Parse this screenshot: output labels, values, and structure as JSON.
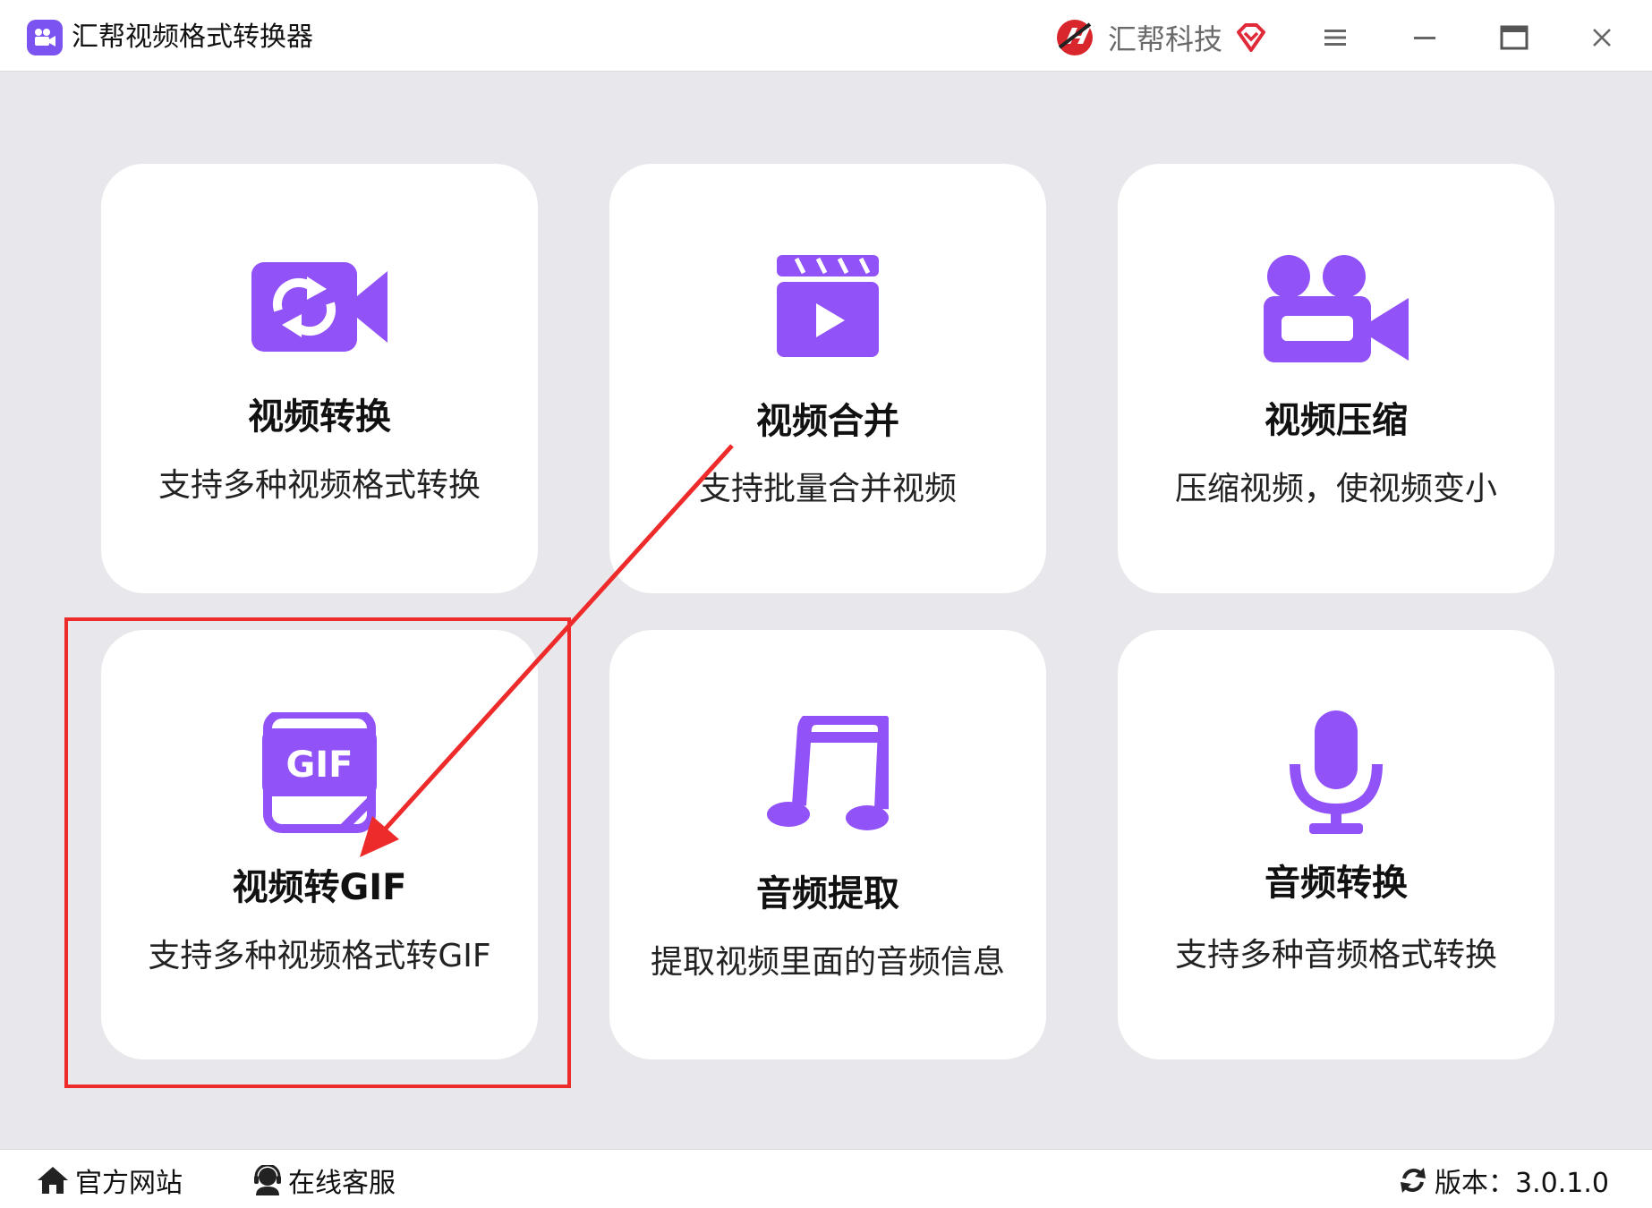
{
  "window": {
    "title": "汇帮视频格式转换器",
    "brand": "汇帮科技"
  },
  "colors": {
    "accent": "#9152f7",
    "highlight": "#ee2b2b",
    "background": "#e8e8ec"
  },
  "cards": [
    {
      "title": "视频转换",
      "desc": "支持多种视频格式转换",
      "icon": "video-convert-icon"
    },
    {
      "title": "视频合并",
      "desc": "支持批量合并视频",
      "icon": "clapperboard-icon"
    },
    {
      "title": "视频压缩",
      "desc": "压缩视频，使视频变小",
      "icon": "video-camera-icon"
    },
    {
      "title": "视频转GIF",
      "desc": "支持多种视频格式转GIF",
      "icon": "gif-file-icon",
      "gif_label": "GIF"
    },
    {
      "title": "音频提取",
      "desc": "提取视频里面的音频信息",
      "icon": "music-note-icon"
    },
    {
      "title": "音频转换",
      "desc": "支持多种音频格式转换",
      "icon": "microphone-icon"
    }
  ],
  "statusbar": {
    "website": "官方网站",
    "support": "在线客服",
    "version": "版本：3.0.1.0"
  }
}
